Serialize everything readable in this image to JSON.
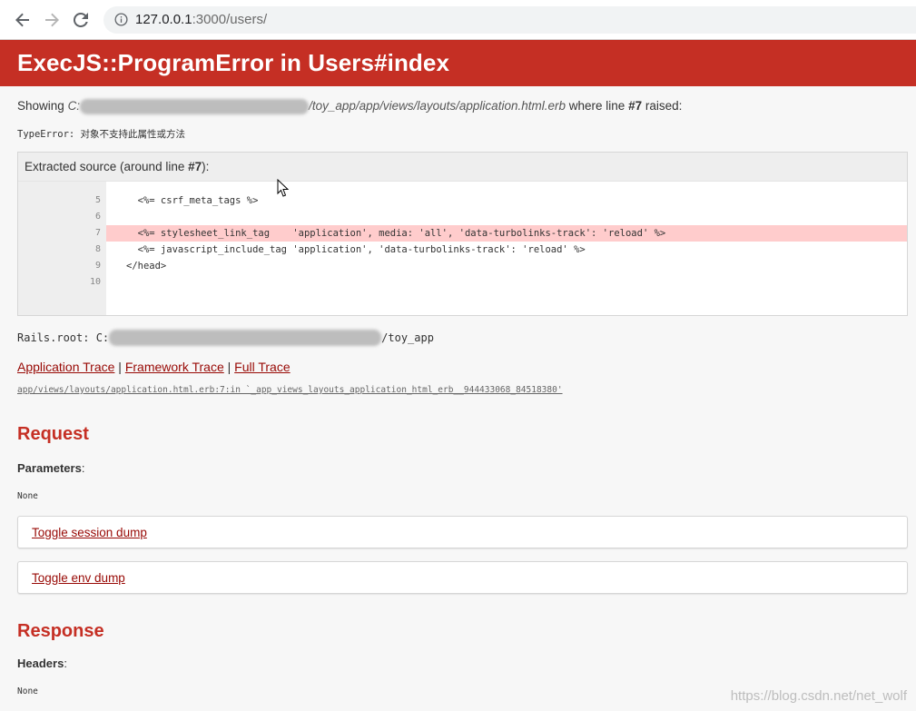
{
  "browser": {
    "url_host": "127.0.0.1",
    "url_path": ":3000/users/",
    "icons": [
      "back-arrow-icon",
      "forward-arrow-icon",
      "reload-icon",
      "info-icon"
    ]
  },
  "error": {
    "title": "ExecJS::ProgramError in Users#index",
    "showing_prefix": "Showing",
    "showing_path_start": "C:",
    "showing_path_end": "/toy_app/app/views/layouts/application.html.erb",
    "showing_where": "where line",
    "showing_line": "#7",
    "showing_raised": "raised:",
    "type_error": "TypeError: 对象不支持此属性或方法"
  },
  "source": {
    "title_prefix": "Extracted source (around line",
    "title_line": "#7",
    "title_suffix": "):",
    "line_numbers": [
      "5",
      "6",
      "7",
      "8",
      "9",
      "10"
    ],
    "lines": [
      "  <%= csrf_meta_tags %>",
      "",
      "  <%= stylesheet_link_tag    'application', media: 'all', 'data-turbolinks-track': 'reload' %>",
      "  <%= javascript_include_tag 'application', 'data-turbolinks-track': 'reload' %>",
      "</head>",
      ""
    ],
    "highlight_line": "7"
  },
  "rails_root": {
    "prefix": "Rails.root: C:",
    "suffix": "/toy_app"
  },
  "traces": {
    "application": "Application Trace",
    "framework": "Framework Trace",
    "full": "Full Trace",
    "separator": "|",
    "trace_line": "app/views/layouts/application.html.erb:7:in `_app_views_layouts_application_html_erb__944433068_84518380'"
  },
  "request": {
    "heading": "Request",
    "params_label": "Parameters",
    "params_value": "None",
    "toggle_session": "Toggle session dump",
    "toggle_env": "Toggle env dump"
  },
  "response": {
    "heading": "Response",
    "headers_label": "Headers",
    "headers_value": "None"
  },
  "watermark": "https://blog.csdn.net/net_wolf",
  "colors": {
    "header_red": "#c52f24",
    "link_red": "#980905",
    "highlight": "#ffcccc"
  }
}
